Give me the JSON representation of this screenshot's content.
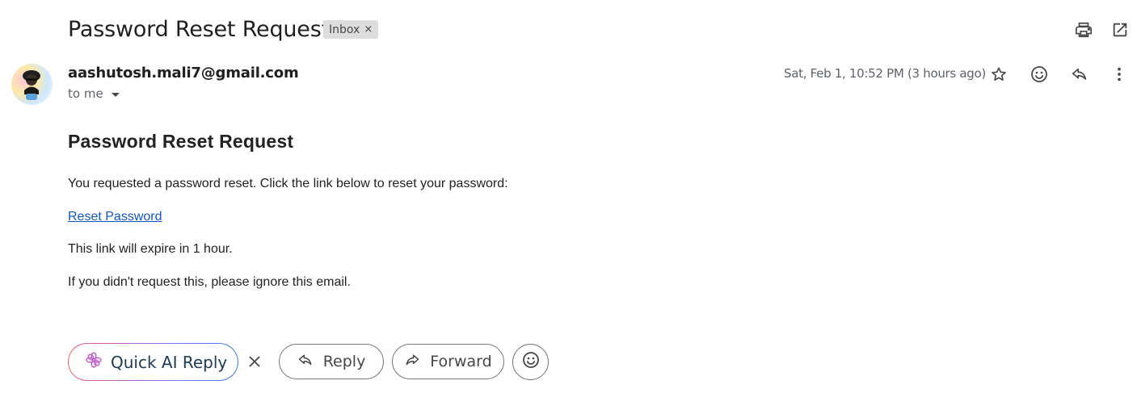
{
  "email": {
    "subject": "Password Reset Request",
    "label": "Inbox",
    "label_remove": "×",
    "sender": "aashutosh.mali7@gmail.com",
    "recipient_text": "to me",
    "date": "Sat, Feb 1, 10:52 PM (3 hours ago)"
  },
  "toolbar": {
    "icons": [
      "print-icon",
      "open-in-new-window-icon"
    ],
    "header_icons": [
      "star-icon",
      "emoji-react-icon",
      "reply-icon",
      "more-vert-icon"
    ]
  },
  "body": {
    "title": "Password Reset Request",
    "intro": "You requested a password reset. Click the link below to reset your password:",
    "link_text": "Reset Password",
    "expiry": "This link will expire in 1 hour.",
    "ignore": "If you didn't request this, please ignore this email."
  },
  "actions": {
    "quick_ai_reply": "Quick AI Reply",
    "reply": "Reply",
    "forward": "Forward"
  },
  "colors": {
    "link": "#1155cc",
    "text": "#222222",
    "muted": "#5f6368",
    "chip_bg": "#dddddd"
  }
}
